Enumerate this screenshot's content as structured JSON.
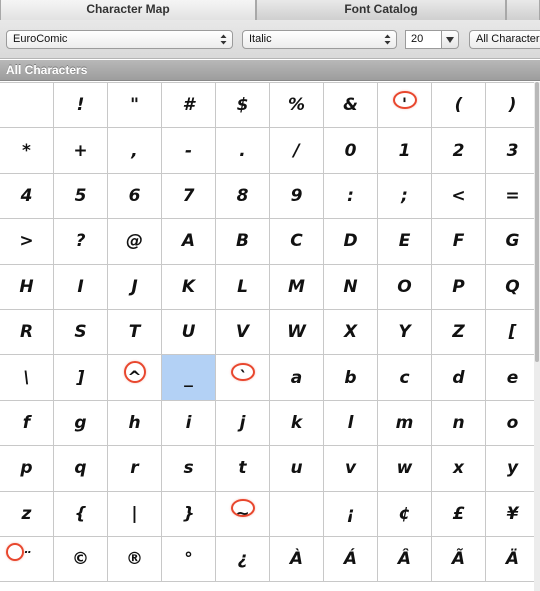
{
  "tabs": [
    {
      "label": "Character Map",
      "active": true
    },
    {
      "label": "Font Catalog",
      "active": false
    }
  ],
  "toolbar": {
    "font_family": "EuroComic",
    "font_style": "Italic",
    "font_size": "20",
    "character_set": "All Characters"
  },
  "section_title": "All Characters",
  "selected_index": 63,
  "accent_color": "#e8472e",
  "selection_color": "#b3d1f5",
  "characters": [
    "",
    "!",
    "\"",
    "#",
    "$",
    "%",
    "&",
    "'",
    "(",
    ")",
    "*",
    "+",
    ",",
    "-",
    ".",
    "/",
    "0",
    "1",
    "2",
    "3",
    "4",
    "5",
    "6",
    "7",
    "8",
    "9",
    ":",
    ";",
    "<",
    "=",
    ">",
    "?",
    "@",
    "A",
    "B",
    "C",
    "D",
    "E",
    "F",
    "G",
    "H",
    "I",
    "J",
    "K",
    "L",
    "M",
    "N",
    "O",
    "P",
    "Q",
    "R",
    "S",
    "T",
    "U",
    "V",
    "W",
    "X",
    "Y",
    "Z",
    "[",
    "\\",
    "]",
    "^",
    "_",
    "`",
    "a",
    "b",
    "c",
    "d",
    "e",
    "f",
    "g",
    "h",
    "i",
    "j",
    "k",
    "l",
    "m",
    "n",
    "o",
    "p",
    "q",
    "r",
    "s",
    "t",
    "u",
    "v",
    "w",
    "x",
    "y",
    "z",
    "{",
    "|",
    "}",
    "~",
    "",
    "¡",
    "¢",
    "£",
    "¥",
    "¨",
    "©",
    "®",
    "°",
    "¿",
    "À",
    "Á",
    "Â",
    "Ã",
    "Ä"
  ],
  "highlighted_indices": [
    7,
    62,
    64,
    94,
    100
  ]
}
